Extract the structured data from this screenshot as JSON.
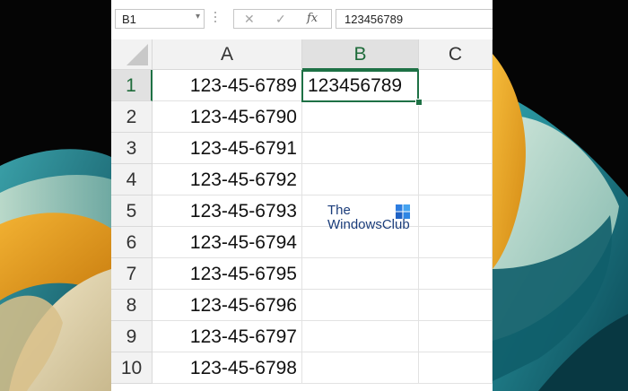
{
  "formula_bar": {
    "name_box_value": "B1",
    "name_box_chevron": "▾",
    "cancel_glyph": "✕",
    "enter_glyph": "✓",
    "fx_glyph": "fx",
    "formula_value": "123456789"
  },
  "grid": {
    "columns": [
      "A",
      "B",
      "C"
    ],
    "selected_column": "B",
    "selected_row": "1",
    "rows": [
      {
        "num": "1",
        "a": "123-45-6789",
        "b": "123456789"
      },
      {
        "num": "2",
        "a": "123-45-6790",
        "b": ""
      },
      {
        "num": "3",
        "a": "123-45-6791",
        "b": ""
      },
      {
        "num": "4",
        "a": "123-45-6792",
        "b": ""
      },
      {
        "num": "5",
        "a": "123-45-6793",
        "b": ""
      },
      {
        "num": "6",
        "a": "123-45-6794",
        "b": ""
      },
      {
        "num": "7",
        "a": "123-45-6795",
        "b": ""
      },
      {
        "num": "8",
        "a": "123-45-6796",
        "b": ""
      },
      {
        "num": "9",
        "a": "123-45-6797",
        "b": ""
      },
      {
        "num": "10",
        "a": "123-45-6798",
        "b": ""
      }
    ]
  },
  "watermark": {
    "line1": "The",
    "line2": "WindowsClub",
    "logo_icon": "windows-logo-icon"
  },
  "colors": {
    "selection_green": "#1e7145",
    "wallpaper_teal": "#2f8f99",
    "wallpaper_gold": "#e9a21c",
    "wallpaper_cream": "#e6d9b4"
  }
}
